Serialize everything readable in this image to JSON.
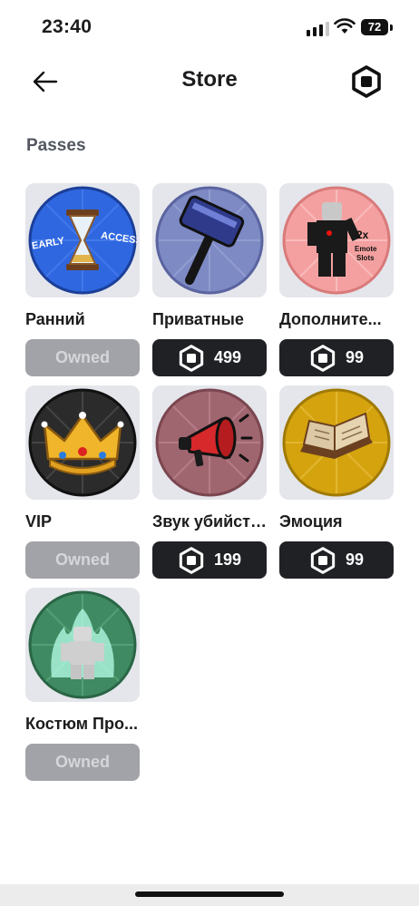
{
  "status_bar": {
    "time": "23:40",
    "battery": "72"
  },
  "header": {
    "title": "Store",
    "back_icon": "arrow-left-icon",
    "currency_icon": "robux-icon"
  },
  "section": {
    "title": "Passes"
  },
  "passes": [
    {
      "name": "Ранний",
      "status": "owned",
      "button_label": "Owned",
      "art_text": [
        "EARLY",
        "ACCESS"
      ]
    },
    {
      "name": "Приватные",
      "status": "price",
      "price": "499"
    },
    {
      "name": "Дополните...",
      "status": "price",
      "price": "99",
      "art_text": [
        "2x",
        "Emote",
        "Slots"
      ]
    },
    {
      "name": "VIP",
      "status": "owned",
      "button_label": "Owned"
    },
    {
      "name": "Звук убийства",
      "status": "price",
      "price": "199"
    },
    {
      "name": "Эмоция",
      "status": "price",
      "price": "99"
    },
    {
      "name": "Костюм Про...",
      "status": "owned",
      "button_label": "Owned"
    }
  ],
  "colors": {
    "owned_button": "#a1a3a8",
    "price_button": "#1f2125",
    "card_background": "#e4e6eb",
    "pass_backgrounds": [
      "#2f67e0",
      "#7e8ac4",
      "#f4a0a0",
      "#2b2b2b",
      "#a06670",
      "#d4a30e",
      "#3f8a62"
    ]
  }
}
